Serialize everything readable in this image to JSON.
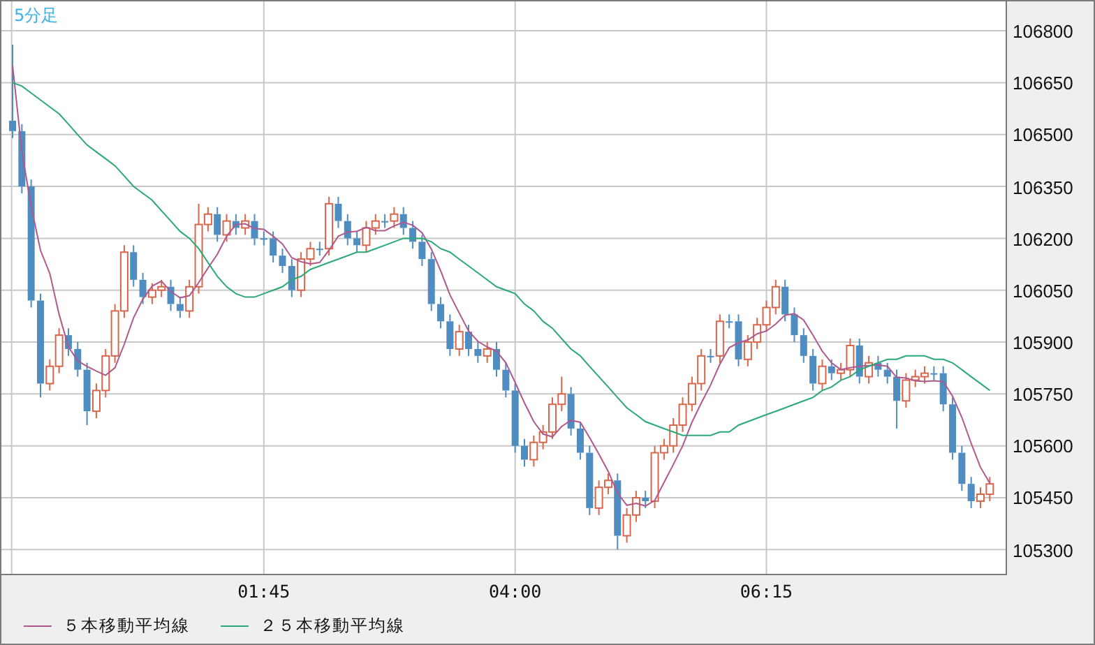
{
  "chart": {
    "title": "5分足",
    "chart_data": {
      "type": "line",
      "grid": true,
      "legend": "bottom",
      "ylim": [
        105230,
        106885
      ],
      "yticks": [
        105300,
        105450,
        105600,
        105750,
        105900,
        106050,
        106200,
        106350,
        106500,
        106650,
        106800
      ],
      "categories": [
        null,
        null,
        null,
        null,
        null,
        null,
        null,
        null,
        null,
        null,
        null,
        null,
        null,
        null,
        null,
        null,
        null,
        null,
        null,
        null,
        null,
        null,
        null,
        null,
        null,
        null,
        null,
        "01:45",
        null,
        null,
        null,
        null,
        null,
        null,
        null,
        null,
        null,
        null,
        null,
        null,
        null,
        null,
        null,
        null,
        null,
        null,
        null,
        null,
        null,
        null,
        null,
        null,
        null,
        null,
        "04:00",
        null,
        null,
        null,
        null,
        null,
        null,
        null,
        null,
        null,
        null,
        null,
        null,
        null,
        null,
        null,
        null,
        null,
        null,
        null,
        null,
        null,
        null,
        null,
        null,
        null,
        null,
        "06:15",
        null,
        null,
        null,
        null,
        null,
        null,
        null,
        null,
        null,
        null,
        null,
        null,
        null,
        null,
        null,
        null,
        null,
        null,
        null,
        null,
        null,
        null,
        null,
        null
      ],
      "series": [
        {
          "name": "５本移動平均線",
          "color": "#b0588c",
          "values": [
            106700,
            106450,
            106293,
            106165,
            106098,
            105980,
            105886,
            105846,
            105830,
            105816,
            105804,
            105826,
            105894,
            105970,
            106024,
            106062,
            106076,
            106046,
            106028,
            106034,
            106072,
            106114,
            106154,
            106206,
            106240,
            106242,
            106228,
            106226,
            106206,
            106184,
            106144,
            106132,
            106126,
            106130,
            106166,
            106206,
            106218,
            106220,
            106232,
            106222,
            106222,
            106236,
            106246,
            106238,
            106216,
            106168,
            106106,
            106036,
            105984,
            105932,
            105902,
            105886,
            105874,
            105840,
            105784,
            105724,
            105670,
            105634,
            105626,
            105656,
            105674,
            105668,
            105624,
            105576,
            105526,
            105464,
            105428,
            105434,
            105426,
            105442,
            105494,
            105546,
            105600,
            105668,
            105724,
            105776,
            105836,
            105884,
            105898,
            105906,
            105924,
            105932,
            105952,
            105978,
            105982,
            105964,
            105920,
            105874,
            105840,
            105820,
            105826,
            105830,
            105832,
            105834,
            105830,
            105798,
            105796,
            105788,
            105786,
            105788,
            105786,
            105744,
            105682,
            105608,
            105538,
            105492
          ]
        },
        {
          "name": "２５本移動平均線",
          "color": "#2aa876",
          "values": [
            106650,
            106640,
            106620,
            106600,
            106580,
            106560,
            106530,
            106500,
            106470,
            106450,
            106430,
            106410,
            106380,
            106350,
            106330,
            106310,
            106280,
            106250,
            106220,
            106200,
            106170,
            106130,
            106090,
            106060,
            106040,
            106030,
            106030,
            106040,
            106050,
            106060,
            106080,
            106090,
            106110,
            106120,
            106130,
            106140,
            106150,
            106160,
            106160,
            106170,
            106180,
            106190,
            106200,
            106200,
            106200,
            106190,
            106170,
            106160,
            106140,
            106120,
            106100,
            106080,
            106060,
            106050,
            106040,
            106010,
            105990,
            105960,
            105940,
            105910,
            105880,
            105860,
            105830,
            105800,
            105770,
            105740,
            105710,
            105690,
            105670,
            105660,
            105650,
            105640,
            105630,
            105630,
            105630,
            105630,
            105640,
            105640,
            105660,
            105670,
            105680,
            105690,
            105700,
            105710,
            105720,
            105730,
            105740,
            105760,
            105770,
            105790,
            105800,
            105820,
            105830,
            105840,
            105850,
            105850,
            105860,
            105860,
            105860,
            105850,
            105850,
            105840,
            105820,
            105800,
            105780,
            105760
          ]
        }
      ]
    },
    "candles": {
      "chart_data": {
        "type": "candlestick",
        "ylim": [
          105230,
          106885
        ],
        "ohlc": [
          [
            106540,
            106760,
            106490,
            106510
          ],
          [
            106510,
            106530,
            106330,
            106350
          ],
          [
            106350,
            106370,
            106000,
            106020
          ],
          [
            106020,
            106040,
            105740,
            105780
          ],
          [
            105780,
            105850,
            105760,
            105830
          ],
          [
            105830,
            105940,
            105810,
            105920
          ],
          [
            105920,
            105940,
            105860,
            105880
          ],
          [
            105880,
            105900,
            105800,
            105820
          ],
          [
            105820,
            105840,
            105660,
            105700
          ],
          [
            105700,
            105780,
            105680,
            105760
          ],
          [
            105760,
            105880,
            105740,
            105860
          ],
          [
            105860,
            106010,
            105840,
            105990
          ],
          [
            105990,
            106180,
            105970,
            106160
          ],
          [
            106160,
            106180,
            106060,
            106080
          ],
          [
            106080,
            106100,
            106010,
            106030
          ],
          [
            106030,
            106070,
            106010,
            106050
          ],
          [
            106050,
            106080,
            106030,
            106060
          ],
          [
            106060,
            106080,
            105990,
            106010
          ],
          [
            106010,
            106030,
            105970,
            105990
          ],
          [
            105990,
            106080,
            105970,
            106060
          ],
          [
            106060,
            106300,
            106040,
            106240
          ],
          [
            106240,
            106290,
            106220,
            106270
          ],
          [
            106270,
            106290,
            106190,
            106210
          ],
          [
            106210,
            106270,
            106190,
            106250
          ],
          [
            106250,
            106270,
            106210,
            106230
          ],
          [
            106230,
            106270,
            106210,
            106250
          ],
          [
            106250,
            106270,
            106180,
            106200
          ],
          [
            106200,
            106220,
            106180,
            106200
          ],
          [
            106200,
            106220,
            106130,
            106150
          ],
          [
            106150,
            106170,
            106100,
            106120
          ],
          [
            106120,
            106140,
            106030,
            106050
          ],
          [
            106050,
            106160,
            106030,
            106140
          ],
          [
            106140,
            106190,
            106120,
            106170
          ],
          [
            106170,
            106190,
            106150,
            106170
          ],
          [
            106170,
            106320,
            106150,
            106300
          ],
          [
            106300,
            106320,
            106230,
            106250
          ],
          [
            106250,
            106270,
            106180,
            106200
          ],
          [
            106200,
            106220,
            106160,
            106180
          ],
          [
            106180,
            106250,
            106160,
            106230
          ],
          [
            106230,
            106270,
            106210,
            106250
          ],
          [
            106250,
            106270,
            106230,
            106250
          ],
          [
            106250,
            106290,
            106230,
            106270
          ],
          [
            106270,
            106290,
            106210,
            106230
          ],
          [
            106230,
            106250,
            106170,
            106190
          ],
          [
            106190,
            106210,
            106120,
            106140
          ],
          [
            106140,
            106160,
            105990,
            106010
          ],
          [
            106010,
            106030,
            105940,
            105960
          ],
          [
            105960,
            105980,
            105860,
            105880
          ],
          [
            105880,
            105950,
            105860,
            105930
          ],
          [
            105930,
            105950,
            105860,
            105880
          ],
          [
            105880,
            105900,
            105840,
            105860
          ],
          [
            105860,
            105900,
            105840,
            105880
          ],
          [
            105880,
            105900,
            105800,
            105820
          ],
          [
            105820,
            105840,
            105740,
            105760
          ],
          [
            105760,
            105780,
            105580,
            105600
          ],
          [
            105600,
            105620,
            105540,
            105560
          ],
          [
            105560,
            105630,
            105540,
            105610
          ],
          [
            105610,
            105660,
            105590,
            105640
          ],
          [
            105640,
            105740,
            105620,
            105720
          ],
          [
            105720,
            105800,
            105700,
            105750
          ],
          [
            105750,
            105770,
            105630,
            105650
          ],
          [
            105650,
            105670,
            105560,
            105580
          ],
          [
            105580,
            105600,
            105400,
            105420
          ],
          [
            105420,
            105500,
            105400,
            105480
          ],
          [
            105480,
            105520,
            105460,
            105500
          ],
          [
            105500,
            105520,
            105300,
            105340
          ],
          [
            105340,
            105420,
            105320,
            105400
          ],
          [
            105400,
            105470,
            105380,
            105450
          ],
          [
            105450,
            105470,
            105420,
            105440
          ],
          [
            105440,
            105600,
            105420,
            105580
          ],
          [
            105580,
            105620,
            105560,
            105600
          ],
          [
            105600,
            105680,
            105580,
            105660
          ],
          [
            105660,
            105740,
            105640,
            105720
          ],
          [
            105720,
            105800,
            105700,
            105780
          ],
          [
            105780,
            105880,
            105760,
            105860
          ],
          [
            105860,
            105880,
            105840,
            105860
          ],
          [
            105860,
            105980,
            105840,
            105960
          ],
          [
            105960,
            105980,
            105940,
            105960
          ],
          [
            105960,
            105980,
            105830,
            105850
          ],
          [
            105850,
            105920,
            105830,
            105900
          ],
          [
            105900,
            105970,
            105880,
            105950
          ],
          [
            105950,
            106020,
            105930,
            106000
          ],
          [
            106000,
            106080,
            105980,
            106060
          ],
          [
            106060,
            106080,
            105960,
            105980
          ],
          [
            105980,
            106000,
            105900,
            105920
          ],
          [
            105920,
            105940,
            105840,
            105860
          ],
          [
            105860,
            105880,
            105760,
            105780
          ],
          [
            105780,
            105850,
            105760,
            105830
          ],
          [
            105830,
            105850,
            105790,
            105810
          ],
          [
            105810,
            105840,
            105790,
            105820
          ],
          [
            105820,
            105910,
            105800,
            105890
          ],
          [
            105890,
            105910,
            105780,
            105800
          ],
          [
            105800,
            105860,
            105780,
            105840
          ],
          [
            105840,
            105860,
            105800,
            105820
          ],
          [
            105820,
            105840,
            105780,
            105800
          ],
          [
            105800,
            105820,
            105650,
            105730
          ],
          [
            105730,
            105810,
            105710,
            105790
          ],
          [
            105790,
            105820,
            105770,
            105800
          ],
          [
            105800,
            105830,
            105780,
            105810
          ],
          [
            105810,
            105830,
            105790,
            105810
          ],
          [
            105810,
            105830,
            105700,
            105720
          ],
          [
            105720,
            105740,
            105560,
            105580
          ],
          [
            105580,
            105600,
            105470,
            105490
          ],
          [
            105490,
            105510,
            105420,
            105440
          ],
          [
            105440,
            105480,
            105420,
            105460
          ],
          [
            105460,
            105510,
            105440,
            105490
          ]
        ]
      }
    }
  }
}
